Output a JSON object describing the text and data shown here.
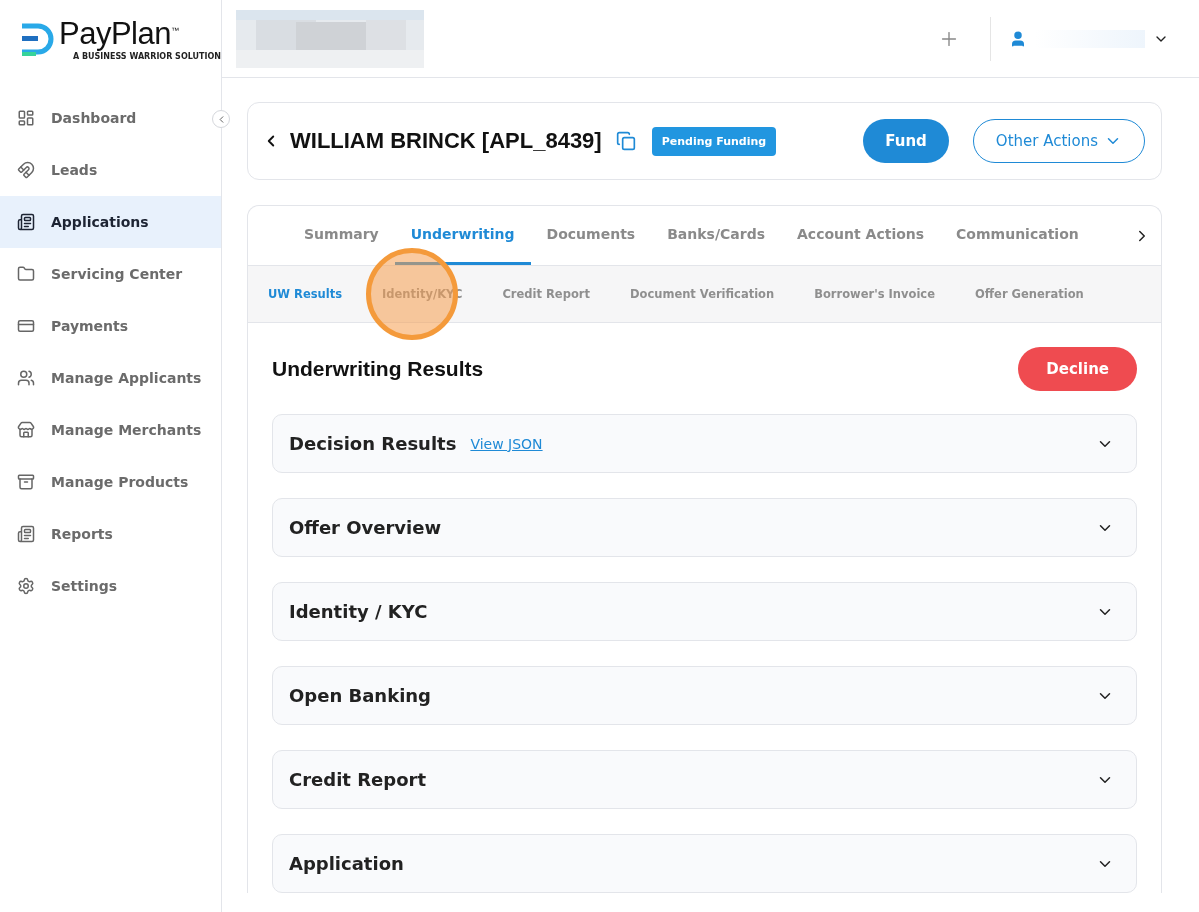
{
  "brand": {
    "name": "PayPlan",
    "trademark": "™",
    "tagline": "A BUSINESS WARRIOR SOLUTION"
  },
  "sidebar": {
    "items": [
      {
        "label": "Dashboard",
        "selected": false
      },
      {
        "label": "Leads",
        "selected": false
      },
      {
        "label": "Applications",
        "selected": true
      },
      {
        "label": "Servicing Center",
        "selected": false
      },
      {
        "label": "Payments",
        "selected": false
      },
      {
        "label": "Manage Applicants",
        "selected": false
      },
      {
        "label": "Manage Merchants",
        "selected": false
      },
      {
        "label": "Manage Products",
        "selected": false
      },
      {
        "label": "Reports",
        "selected": false
      },
      {
        "label": "Settings",
        "selected": false
      }
    ]
  },
  "header": {
    "title": "WILLIAM BRINCK [APL_8439]",
    "status": "Pending Funding",
    "buttons": [
      {
        "label": "Fund",
        "kind": "primary"
      },
      {
        "label": "Other Actions",
        "kind": "outline"
      }
    ]
  },
  "tabs": [
    {
      "label": "Summary",
      "selected": false
    },
    {
      "label": "Underwriting",
      "selected": true
    },
    {
      "label": "Documents",
      "selected": false
    },
    {
      "label": "Banks/Cards",
      "selected": false
    },
    {
      "label": "Account Actions",
      "selected": false
    },
    {
      "label": "Communication",
      "selected": false
    }
  ],
  "subtabs": [
    {
      "label": "UW Results",
      "selected": true
    },
    {
      "label": "Identity/KYC",
      "selected": false
    },
    {
      "label": "Credit Report",
      "selected": false
    },
    {
      "label": "Document Verification",
      "selected": false
    },
    {
      "label": "Borrower's Invoice",
      "selected": false
    },
    {
      "label": "Offer Generation",
      "selected": false
    }
  ],
  "section": {
    "title": "Underwriting Results",
    "action": "Decline"
  },
  "accordions": [
    {
      "title": "Decision Results",
      "link": "View JSON",
      "expanded": false
    },
    {
      "title": "Offer Overview",
      "expanded": false
    },
    {
      "title": "Identity / KYC",
      "expanded": false
    },
    {
      "title": "Open Banking",
      "expanded": false
    },
    {
      "title": "Credit Report",
      "expanded": false
    },
    {
      "title": "Application",
      "expanded": false
    }
  ]
}
